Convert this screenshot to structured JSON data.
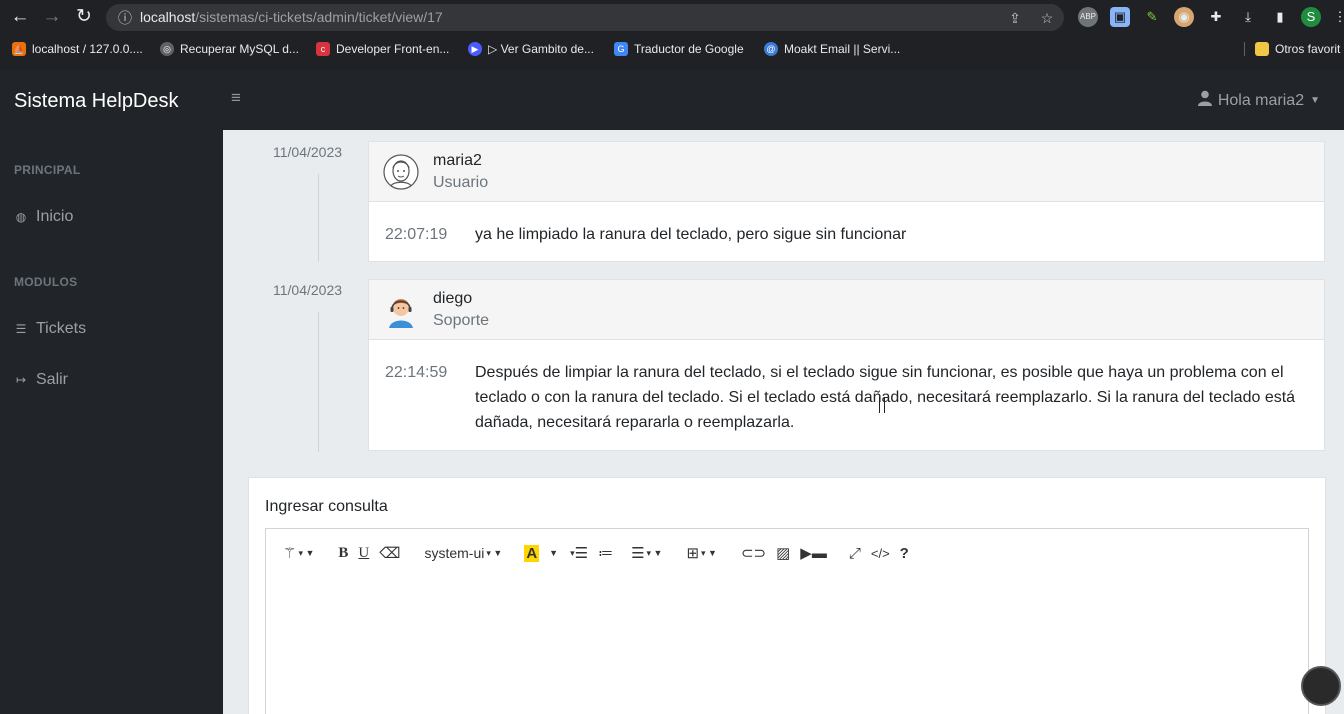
{
  "browser": {
    "url_host": "localhost",
    "url_path": "/sistemas/ci-tickets/admin/ticket/view/17",
    "profile_initial": "S",
    "bookmarks": [
      {
        "label": "localhost / 127.0.0...."
      },
      {
        "label": "Recuperar MySQL d..."
      },
      {
        "label": "Developer Front-en..."
      },
      {
        "label": "▷ Ver Gambito de..."
      },
      {
        "label": "Traductor de Google"
      },
      {
        "label": "Moakt Email || Servi..."
      },
      {
        "label": "Otros favorit"
      }
    ]
  },
  "sidebar": {
    "brand": "Sistema HelpDesk",
    "section_principal": "PRINCIPAL",
    "item_inicio": "Inicio",
    "section_modulos": "MODULOS",
    "item_tickets": "Tickets",
    "item_salir": "Salir"
  },
  "topbar": {
    "user_greeting": "Hola maria2"
  },
  "timeline": [
    {
      "date": "11/04/2023",
      "user": "maria2",
      "role": "Usuario",
      "time": "22:07:19",
      "message": "ya he limpiado la ranura del teclado, pero sigue sin funcionar"
    },
    {
      "date": "11/04/2023",
      "user": "diego",
      "role": "Soporte",
      "time": "22:14:59",
      "message": "Después de limpiar la ranura del teclado, si el teclado sigue sin funcionar, es posible que haya un problema con el teclado o con la ranura del teclado. Si el teclado está dañado, necesitará reemplazarlo. Si la ranura del teclado está dañada, necesitará repararla o reemplazarla."
    }
  ],
  "consulta": {
    "label": "Ingresar consulta",
    "font_select": "system-ui",
    "help": "?",
    "code_view": "</>"
  },
  "colors": {
    "sidebar_bg": "#212529",
    "content_bg": "#e9ecef",
    "card_header_bg": "#f5f5f5",
    "highlight_icon": "#ffd500"
  }
}
